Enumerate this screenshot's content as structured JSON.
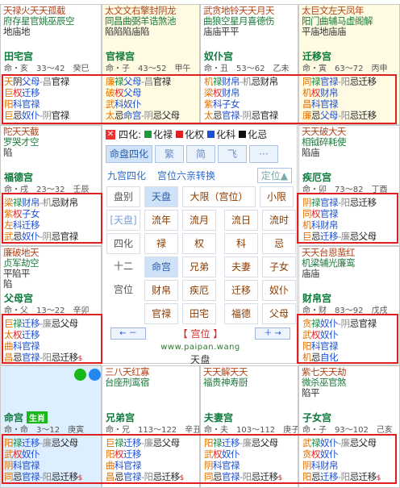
{
  "palaces": [
    {
      "id": "tianzhai",
      "stars": [
        "天禄火天天孤截",
        "府存星官姚巫辰空",
        "地庙地"
      ],
      "name": "田宅宫",
      "age": "命・亥　33～42　癸巳",
      "sihua": [
        [
          "天",
          "阴",
          "父母",
          "昌",
          "官禄"
        ],
        [
          "巨",
          "权",
          "迁移",
          ""
        ],
        [
          "阳",
          "科",
          "官禄",
          ""
        ],
        [
          "巨",
          "忌",
          "奴仆",
          "阴",
          "官禄"
        ]
      ]
    },
    {
      "id": "guanlu",
      "stars": [
        "太文文右擎封阴龙",
        "同昌曲弼羊诰煞池",
        "陷陷陷庙陷"
      ],
      "name": "官禄宫",
      "age": "命・子　43～52　甲午",
      "sihua": [
        [
          "廉",
          "禄",
          "父母",
          "昌",
          "官禄"
        ],
        [
          "破",
          "权",
          "父母",
          ""
        ],
        [
          "武",
          "科",
          "奴仆",
          ""
        ],
        [
          "太",
          "忌",
          "命宫",
          "阴",
          "忌父母"
        ]
      ]
    },
    {
      "id": "nupu",
      "stars": [
        "武贪地铃天天月天",
        "曲狼空星月喜德伤",
        "庙庙平平"
      ],
      "name": "奴仆宫",
      "age": "命・丑　53～62　乙未",
      "sihua": [
        [
          "机",
          "禄",
          "财帛",
          "机",
          "忌财帛"
        ],
        [
          "梁",
          "权",
          "财帛",
          ""
        ],
        [
          "紫",
          "科",
          "子女",
          ""
        ],
        [
          "太",
          "忌",
          "官禄",
          "阴",
          "忌官禄"
        ]
      ]
    },
    {
      "id": "qianyi",
      "stars": [
        "太巨文左天凤年",
        "阳门曲辅马虚阁解",
        "平庙地庙庙"
      ],
      "name": "迁移宫",
      "age": "命・寅　63～72　丙申",
      "sihua": [
        [
          "同",
          "禄",
          "官禄",
          "阳",
          "忌迁移"
        ],
        [
          "机",
          "权",
          "财帛",
          ""
        ],
        [
          "昌",
          "科",
          "官禄",
          ""
        ],
        [
          "廉",
          "忌",
          "父母",
          "阳",
          "忌迁移"
        ]
      ]
    },
    {
      "id": "fude",
      "stars": [
        "陀天天截",
        "罗哭才空",
        "陷"
      ],
      "name": "福德宫",
      "age": "命・戌　23～32　壬辰",
      "sihua": [
        [
          "梁",
          "禄",
          "财帛",
          "机",
          "忌财帛"
        ],
        [
          "紫",
          "权",
          "子女",
          ""
        ],
        [
          "左",
          "科",
          "迁移",
          ""
        ],
        [
          "武",
          "忌",
          "奴仆",
          "阴",
          "忌官禄"
        ]
      ]
    },
    {
      "id": "jie",
      "stars": [
        "天天破大天",
        "相钺碎耗使",
        "陷庙"
      ],
      "name": "疾厄宫",
      "age": "命・卯　73～82　丁酉",
      "sihua": [
        [
          "阴",
          "禄",
          "官禄",
          "阳",
          "忌迁移"
        ],
        [
          "同",
          "权",
          "官禄",
          ""
        ],
        [
          "机",
          "科",
          "财帛",
          ""
        ],
        [
          "巨",
          "忌",
          "迁移",
          "廉",
          "忌父母"
        ]
      ]
    },
    {
      "id": "fumu",
      "stars": [
        "廉破地天",
        "贞军劫空",
        "平陷平",
        "陷"
      ],
      "name": "父母宫",
      "age": "命・父　13～22　辛卯",
      "sihua": [
        [
          "巨",
          "禄",
          "迁移",
          "廉",
          "忌父母"
        ],
        [
          "太",
          "权",
          "迁移",
          ""
        ],
        [
          "曲",
          "科",
          "官禄",
          ""
        ],
        [
          "昌",
          "忌",
          "官禄",
          "阳",
          "忌迁移$"
        ]
      ]
    },
    {
      "id": "caibo",
      "stars": [
        "天天台恩蜚红",
        "机梁辅光廉鸾",
        "庙庙"
      ],
      "name": "财帛宫",
      "age": "命・财　83～92　戊戌",
      "sihua": [
        [
          "贪",
          "禄",
          "奴仆",
          "阴",
          "忌官禄"
        ],
        [
          "武",
          "权",
          "奴仆",
          ""
        ],
        [
          "阳",
          "科",
          "官禄",
          ""
        ],
        [
          "机",
          "忌",
          "自化",
          ""
        ]
      ]
    },
    {
      "id": "ming",
      "stars": [],
      "name": "命宫",
      "age": "命・命　3～12　庚寅",
      "tag": "生肖",
      "sihua": [
        [
          "阳",
          "禄",
          "迁移",
          "廉",
          "忌父母"
        ],
        [
          "武",
          "权",
          "奴仆",
          ""
        ],
        [
          "阴",
          "科",
          "官禄",
          ""
        ],
        [
          "同",
          "忌",
          "官禄",
          "阳",
          "忌迁移$"
        ]
      ]
    },
    {
      "id": "xiongdi",
      "stars": [
        "三八天红寡",
        "台座刑鸾宿"
      ],
      "name": "兄弟宫",
      "age": "命・兄　113～122　辛丑",
      "sihua": [
        [
          "巨",
          "禄",
          "迁移",
          "廉",
          "忌父母"
        ],
        [
          "阳",
          "权",
          "迁移",
          ""
        ],
        [
          "曲",
          "科",
          "官禄",
          ""
        ],
        [
          "昌",
          "忌",
          "官禄",
          "阳",
          "忌迁移$"
        ]
      ]
    },
    {
      "id": "fuqi",
      "stars": [
        "天天解天天",
        "福贵神寿厨"
      ],
      "name": "夫妻宫",
      "age": "命・夫　103～112　庚子",
      "sihua": [
        [
          "阳",
          "禄",
          "迁移",
          "廉",
          "忌父母"
        ],
        [
          "武",
          "权",
          "奴仆",
          ""
        ],
        [
          "阴",
          "科",
          "官禄",
          ""
        ],
        [
          "同",
          "忌",
          "官禄",
          "阳",
          "忌迁移$"
        ]
      ]
    },
    {
      "id": "zinv",
      "stars": [
        "紫七天天劫",
        "微杀巫官煞",
        "陷平"
      ],
      "name": "子女宫",
      "age": "命・子　93～102　己亥",
      "sihua": [
        [
          "武",
          "禄",
          "奴仆",
          "廉",
          "忌父母"
        ],
        [
          "贪",
          "权",
          "奴仆",
          ""
        ],
        [
          "阴",
          "科",
          "财帛",
          ""
        ],
        [
          "阳",
          "忌",
          "迁移",
          "阳",
          "忌迁移$"
        ]
      ]
    }
  ],
  "center": {
    "legend": {
      "title": "四化:",
      "items": [
        "化禄",
        "化权",
        "化科",
        "化忌"
      ],
      "colors": [
        "#1a9a3a",
        "#e02020",
        "#1a4fd6",
        "#111111"
      ]
    },
    "tabs": [
      "命盘四化",
      "繁",
      "简",
      "飞",
      "···"
    ],
    "opt1": "九宫四化",
    "opt2": "宫位六亲转换",
    "opt3": "定位▲",
    "rows": [
      [
        "盘别",
        "天盘",
        "大限（宫位）",
        "小限"
      ],
      [
        "[天盘]",
        "流年",
        "流月",
        "流日",
        "流时"
      ],
      [
        "四化",
        "禄",
        "权",
        "科",
        "忌"
      ],
      [
        "十二",
        "命宫",
        "兄弟",
        "夫妻",
        "子女"
      ],
      [
        "宫位",
        "财帛",
        "疾厄",
        "迁移",
        "奴仆"
      ],
      [
        "",
        "官禄",
        "田宅",
        "福德",
        "父母"
      ]
    ],
    "nav_prev": "← －",
    "nav_mid": "【 宫位 】",
    "nav_next": "＋ →",
    "site": "www.paipan.wang",
    "board": "天盘"
  }
}
